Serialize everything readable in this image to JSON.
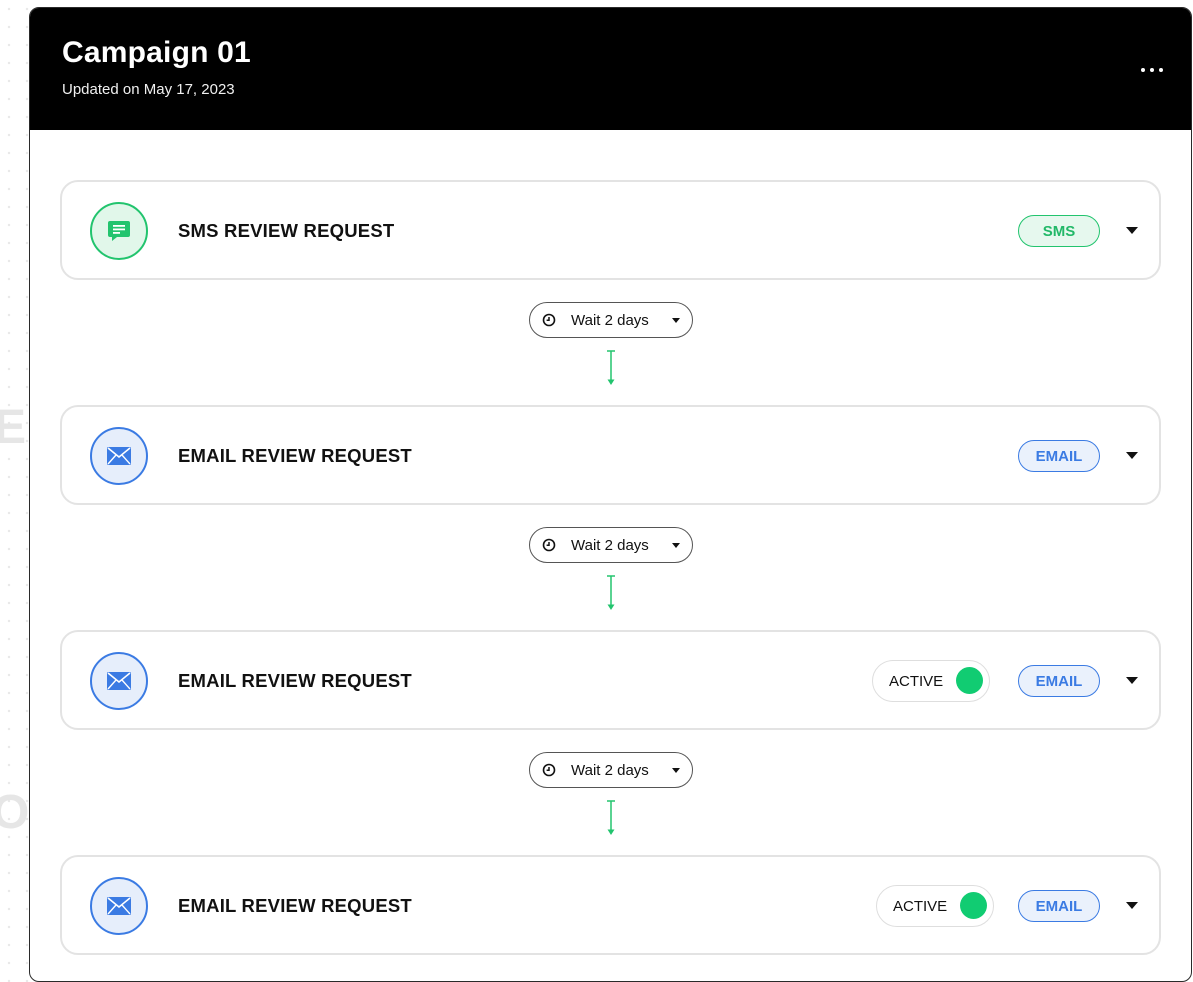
{
  "campaign": {
    "title": "Campaign 01",
    "updated": "Updated on May 17, 2023"
  },
  "colors": {
    "header_bg": "#000000",
    "sms_green": "#22c46e",
    "email_blue": "#3b7be3",
    "active_green": "#11cc72"
  },
  "steps": [
    {
      "title": "SMS REVIEW REQUEST",
      "badge": "SMS",
      "channel": "sms",
      "icon": "chat-icon"
    },
    {
      "title": "EMAIL REVIEW REQUEST",
      "badge": "EMAIL",
      "channel": "email",
      "icon": "mail-icon"
    },
    {
      "title": "EMAIL REVIEW REQUEST",
      "badge": "EMAIL",
      "channel": "email",
      "icon": "mail-icon",
      "status": "ACTIVE"
    },
    {
      "title": "EMAIL REVIEW REQUEST",
      "badge": "EMAIL",
      "channel": "email",
      "icon": "mail-icon",
      "status": "ACTIVE"
    }
  ],
  "waits": [
    {
      "label": "Wait 2 days"
    },
    {
      "label": "Wait 2 days"
    },
    {
      "label": "Wait 2 days"
    }
  ]
}
